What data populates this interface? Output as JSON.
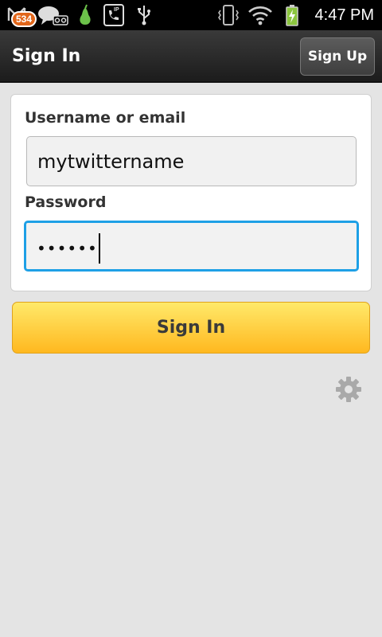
{
  "status_bar": {
    "notification_count": "534",
    "time": "4:47 PM",
    "icons": [
      "notification-icon",
      "voicemail-icon",
      "pear-app-icon",
      "sip-call-icon",
      "usb-icon",
      "vibrate-icon",
      "wifi-icon",
      "battery-charging-icon"
    ]
  },
  "action_bar": {
    "title": "Sign In",
    "signup_label": "Sign Up"
  },
  "form": {
    "username_label": "Username or email",
    "username_value": "mytwittername",
    "password_label": "Password",
    "password_value": "••••••"
  },
  "signin_label": "Sign In",
  "colors": {
    "accent_focus": "#1ea0e6",
    "button_top": "#ffe96a",
    "button_bottom": "#ffb81f",
    "badge": "#e1661a"
  }
}
